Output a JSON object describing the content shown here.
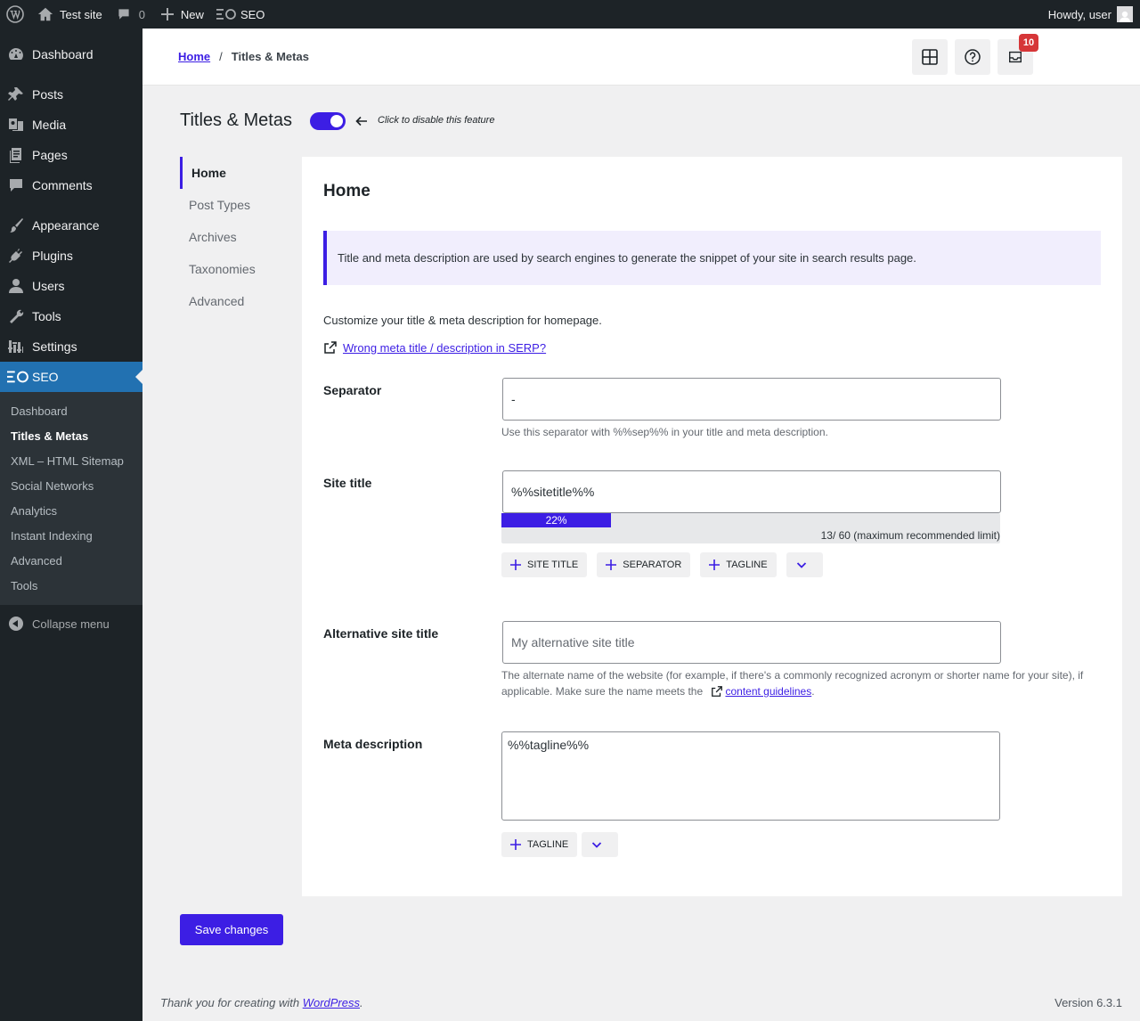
{
  "adminbar": {
    "site_name": "Test site",
    "comments_count": "0",
    "new_label": "New",
    "seo_label": "SEO",
    "howdy": "Howdy, user"
  },
  "sidebar": {
    "items": [
      {
        "label": "Dashboard",
        "icon": "dashboard-icon"
      },
      {
        "label": "Posts",
        "icon": "pin-icon"
      },
      {
        "label": "Media",
        "icon": "media-icon"
      },
      {
        "label": "Pages",
        "icon": "pages-icon"
      },
      {
        "label": "Comments",
        "icon": "comment-icon"
      },
      {
        "label": "Appearance",
        "icon": "brush-icon"
      },
      {
        "label": "Plugins",
        "icon": "plug-icon"
      },
      {
        "label": "Users",
        "icon": "user-icon"
      },
      {
        "label": "Tools",
        "icon": "wrench-icon"
      },
      {
        "label": "Settings",
        "icon": "settings-icon"
      },
      {
        "label": "SEO",
        "icon": "seo-icon"
      }
    ],
    "submenu": [
      "Dashboard",
      "Titles & Metas",
      "XML – HTML Sitemap",
      "Social Networks",
      "Analytics",
      "Instant Indexing",
      "Advanced",
      "Tools"
    ],
    "collapse": "Collapse menu"
  },
  "header": {
    "crumb_home": "Home",
    "crumb_sep": "/",
    "crumb_current": "Titles & Metas",
    "notifications_count": "10"
  },
  "page": {
    "title": "Titles & Metas",
    "toggle_hint": "Click to disable this feature",
    "toggle_on": true
  },
  "subnav": [
    "Home",
    "Post Types",
    "Archives",
    "Taxonomies",
    "Advanced"
  ],
  "panel": {
    "heading": "Home",
    "notice": "Title and meta description are used by search engines to generate the snippet of your site in search results page.",
    "description": "Customize your title & meta description for homepage.",
    "serp_link": "Wrong meta title / description in SERP?",
    "separator": {
      "label": "Separator",
      "value": "-",
      "help": "Use this separator with %%sep%% in your title and meta description."
    },
    "site_title": {
      "label": "Site title",
      "value": "%%sitetitle%%",
      "progress_label": "22%",
      "progress_fraction": 0.22,
      "count": "13/ 60 (maximum recommended limit)",
      "tags": [
        "SITE TITLE",
        "SEPARATOR",
        "TAGLINE"
      ]
    },
    "alt_title": {
      "label": "Alternative site title",
      "placeholder": "My alternative site title",
      "help": "The alternate name of the website (for example, if there's a commonly recognized acronym or shorter name for your site), if applicable. Make sure the name meets the",
      "help_link": "content guidelines",
      "help_end": "."
    },
    "meta_desc": {
      "label": "Meta description",
      "value": "%%tagline%%",
      "tags": [
        "TAGLINE"
      ]
    }
  },
  "save_label": "Save changes",
  "footer": {
    "text": "Thank you for creating with",
    "link": "WordPress",
    "end": ".",
    "version": "Version 6.3.1"
  },
  "colors": {
    "accent": "#3c1ee4",
    "admin_dark": "#1d2327",
    "wp_blue": "#2271b1",
    "badge": "#d63638"
  }
}
